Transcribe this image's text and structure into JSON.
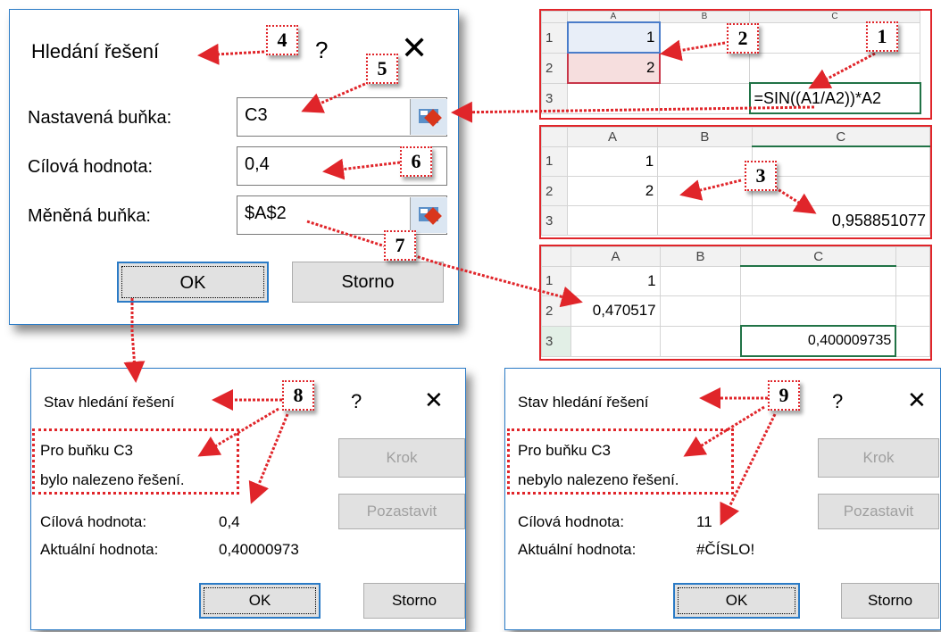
{
  "goal_seek_dialog": {
    "title": "Hledání řešení",
    "help": "?",
    "close": "✕",
    "set_cell_label": "Nastavená buňka:",
    "set_cell_value": "C3",
    "target_value_label": "Cílová hodnota:",
    "target_value_value": "0,4",
    "changing_cell_label": "Měněná buňka:",
    "changing_cell_value": "$A$2",
    "ok": "OK",
    "cancel": "Storno"
  },
  "sheet1": {
    "col_a": "A",
    "col_b": "B",
    "col_c": "C",
    "row1": "1",
    "row2": "2",
    "row3": "3",
    "a1": "1",
    "a2": "2",
    "c3_formula": "=SIN((A1/A2))*A2"
  },
  "sheet2": {
    "col_a": "A",
    "col_b": "B",
    "col_c": "C",
    "row1": "1",
    "row2": "2",
    "row3": "3",
    "a1": "1",
    "a2": "2",
    "c3": "0,958851077"
  },
  "sheet3": {
    "col_a": "A",
    "col_b": "B",
    "col_c": "C",
    "row1": "1",
    "row2": "2",
    "row3": "3",
    "a1": "1",
    "a2": "0,470517",
    "c3": "0,400009735"
  },
  "status_success": {
    "title": "Stav hledání řešení",
    "help": "?",
    "close": "✕",
    "line1": "Pro buňku C3",
    "line2": "bylo nalezeno řešení.",
    "target_label": "Cílová hodnota:",
    "target_value": "0,4",
    "current_label": "Aktuální hodnota:",
    "current_value": "0,40000973",
    "step": "Krok",
    "pause": "Pozastavit",
    "ok": "OK",
    "cancel": "Storno"
  },
  "status_failure": {
    "title": "Stav hledání řešení",
    "help": "?",
    "close": "✕",
    "line1": "Pro buňku C3",
    "line2": "nebylo nalezeno řešení.",
    "target_label": "Cílová hodnota:",
    "target_value": "11",
    "current_label": "Aktuální hodnota:",
    "current_value": "#ČÍSLO!",
    "step": "Krok",
    "pause": "Pozastavit",
    "ok": "OK",
    "cancel": "Storno"
  },
  "callouts": {
    "n1": "1",
    "n2": "2",
    "n3": "3",
    "n4": "4",
    "n5": "5",
    "n6": "6",
    "n7": "7",
    "n8": "8",
    "n9": "9"
  },
  "colors": {
    "annotation_red": "#e0252a",
    "dialog_border_blue": "#2b7bc6",
    "cell_selected_green": "#217346"
  }
}
